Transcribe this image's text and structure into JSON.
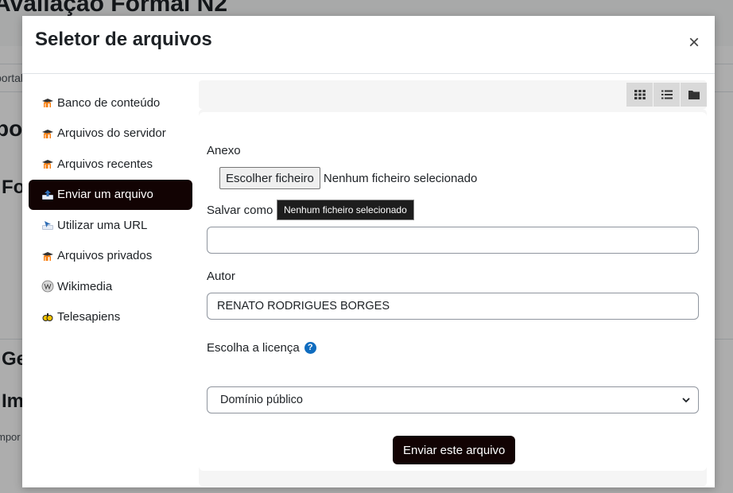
{
  "background": {
    "page_title": "Avaliação Formal N2",
    "tab_fragment": "portal",
    "headings": [
      "po",
      "Fo",
      "Ge",
      "Im"
    ],
    "text_fragment": "mpor"
  },
  "modal": {
    "title": "Seletor de arquivos",
    "close_label": "×"
  },
  "repositories": [
    {
      "label": "Banco de conteúdo",
      "icon": "moodle-icon"
    },
    {
      "label": "Arquivos do servidor",
      "icon": "moodle-icon"
    },
    {
      "label": "Arquivos recentes",
      "icon": "moodle-icon"
    },
    {
      "label": "Enviar um arquivo",
      "icon": "upload-icon",
      "active": true
    },
    {
      "label": "Utilizar uma URL",
      "icon": "url-icon"
    },
    {
      "label": "Arquivos privados",
      "icon": "moodle-icon"
    },
    {
      "label": "Wikimedia",
      "icon": "wikimedia-icon"
    },
    {
      "label": "Telesapiens",
      "icon": "telesapiens-icon"
    }
  ],
  "toolbar": {
    "view_icons": [
      "grid-view-icon",
      "list-view-icon",
      "folder-view-icon"
    ]
  },
  "form": {
    "attachment_label": "Anexo",
    "choose_file_button": "Escolher ficheiro",
    "no_file_text": "Nenhum ficheiro selecionado",
    "tooltip_text": "Nenhum ficheiro selecionado",
    "save_as_label": "Salvar como",
    "save_as_value": "",
    "author_label": "Autor",
    "author_value": "RENATO RODRIGUES BORGES",
    "license_label": "Escolha a licença",
    "license_value": "Domínio público",
    "submit_button": "Enviar este arquivo"
  },
  "colors": {
    "primary_dark": "#120303",
    "help_icon": "#0f6cbf"
  }
}
